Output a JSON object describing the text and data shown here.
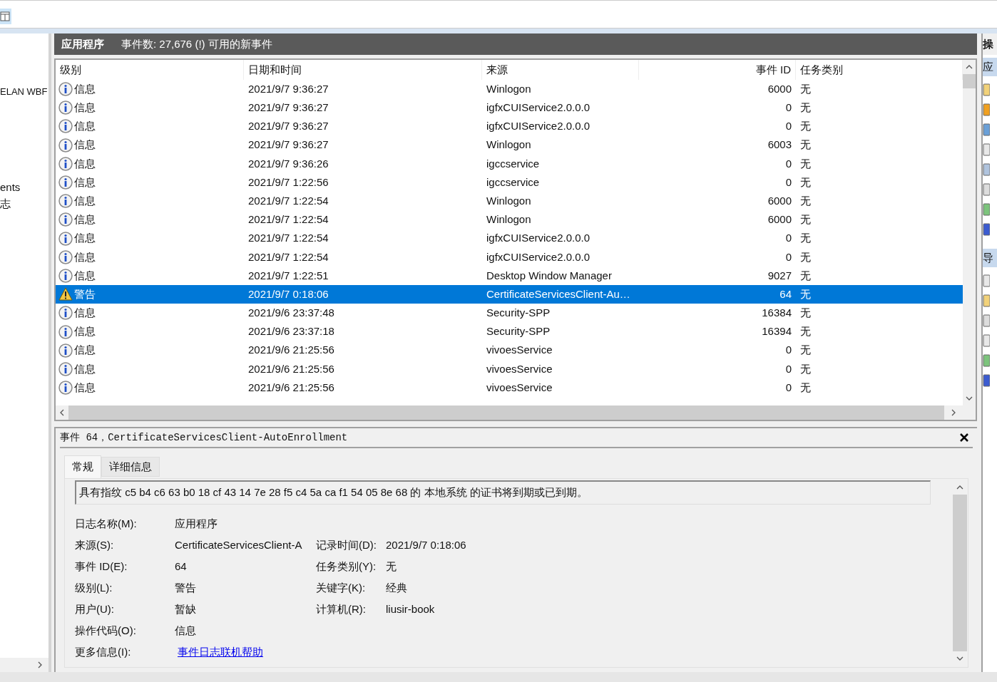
{
  "sidebar": {
    "items": [
      {
        "label": "ELAN WBF"
      },
      {
        "label": "ents"
      },
      {
        "label": "志"
      }
    ]
  },
  "log_header": {
    "title": "应用程序",
    "summary": "事件数: 27,676 (!) 可用的新事件"
  },
  "table": {
    "columns": [
      "级别",
      "日期和时间",
      "来源",
      "事件 ID",
      "任务类别"
    ],
    "rows": [
      {
        "kind": "info",
        "level": "信息",
        "datetime": "2021/9/7 9:36:27",
        "source": "Winlogon",
        "event_id": "6000",
        "task": "无",
        "selected": false
      },
      {
        "kind": "info",
        "level": "信息",
        "datetime": "2021/9/7 9:36:27",
        "source": "igfxCUIService2.0.0.0",
        "event_id": "0",
        "task": "无",
        "selected": false
      },
      {
        "kind": "info",
        "level": "信息",
        "datetime": "2021/9/7 9:36:27",
        "source": "igfxCUIService2.0.0.0",
        "event_id": "0",
        "task": "无",
        "selected": false
      },
      {
        "kind": "info",
        "level": "信息",
        "datetime": "2021/9/7 9:36:27",
        "source": "Winlogon",
        "event_id": "6003",
        "task": "无",
        "selected": false
      },
      {
        "kind": "info",
        "level": "信息",
        "datetime": "2021/9/7 9:36:26",
        "source": "igccservice",
        "event_id": "0",
        "task": "无",
        "selected": false
      },
      {
        "kind": "info",
        "level": "信息",
        "datetime": "2021/9/7 1:22:56",
        "source": "igccservice",
        "event_id": "0",
        "task": "无",
        "selected": false
      },
      {
        "kind": "info",
        "level": "信息",
        "datetime": "2021/9/7 1:22:54",
        "source": "Winlogon",
        "event_id": "6000",
        "task": "无",
        "selected": false
      },
      {
        "kind": "info",
        "level": "信息",
        "datetime": "2021/9/7 1:22:54",
        "source": "Winlogon",
        "event_id": "6000",
        "task": "无",
        "selected": false
      },
      {
        "kind": "info",
        "level": "信息",
        "datetime": "2021/9/7 1:22:54",
        "source": "igfxCUIService2.0.0.0",
        "event_id": "0",
        "task": "无",
        "selected": false
      },
      {
        "kind": "info",
        "level": "信息",
        "datetime": "2021/9/7 1:22:54",
        "source": "igfxCUIService2.0.0.0",
        "event_id": "0",
        "task": "无",
        "selected": false
      },
      {
        "kind": "info",
        "level": "信息",
        "datetime": "2021/9/7 1:22:51",
        "source": "Desktop Window Manager",
        "event_id": "9027",
        "task": "无",
        "selected": false
      },
      {
        "kind": "warning",
        "level": "警告",
        "datetime": "2021/9/7 0:18:06",
        "source": "CertificateServicesClient-Au…",
        "event_id": "64",
        "task": "无",
        "selected": true
      },
      {
        "kind": "info",
        "level": "信息",
        "datetime": "2021/9/6 23:37:48",
        "source": "Security-SPP",
        "event_id": "16384",
        "task": "无",
        "selected": false
      },
      {
        "kind": "info",
        "level": "信息",
        "datetime": "2021/9/6 23:37:18",
        "source": "Security-SPP",
        "event_id": "16394",
        "task": "无",
        "selected": false
      },
      {
        "kind": "info",
        "level": "信息",
        "datetime": "2021/9/6 21:25:56",
        "source": "vivoesService",
        "event_id": "0",
        "task": "无",
        "selected": false
      },
      {
        "kind": "info",
        "level": "信息",
        "datetime": "2021/9/6 21:25:56",
        "source": "vivoesService",
        "event_id": "0",
        "task": "无",
        "selected": false
      },
      {
        "kind": "info",
        "level": "信息",
        "datetime": "2021/9/6 21:25:56",
        "source": "vivoesService",
        "event_id": "0",
        "task": "无",
        "selected": false
      }
    ]
  },
  "details": {
    "title": "事件 64，CertificateServicesClient-AutoEnrollment",
    "tabs": [
      {
        "label": "常规",
        "selected": true
      },
      {
        "label": "详细信息",
        "selected": false
      }
    ],
    "message": "具有指纹 c5 b4 c6 63 b0 18 cf 43 14 7e 28 f5 c4 5a ca f1 54 05 8e 68 的 本地系统 的证书将到期或已到期。",
    "rows": [
      [
        {
          "label": "日志名称(M):",
          "value": "应用程序",
          "kind": "text"
        }
      ],
      [
        {
          "label": "来源(S):",
          "value": "CertificateServicesClient-A",
          "kind": "text"
        },
        {
          "label": "记录时间(D):",
          "value": "2021/9/7 0:18:06",
          "kind": "text"
        }
      ],
      [
        {
          "label": "事件 ID(E):",
          "value": "64",
          "kind": "text"
        },
        {
          "label": "任务类别(Y):",
          "value": "无",
          "kind": "text"
        }
      ],
      [
        {
          "label": "级别(L):",
          "value": "警告",
          "kind": "text"
        },
        {
          "label": "关键字(K):",
          "value": "经典",
          "kind": "text"
        }
      ],
      [
        {
          "label": "用户(U):",
          "value": "暂缺",
          "kind": "text"
        },
        {
          "label": "计算机(R):",
          "value": "liusir-book",
          "kind": "text"
        }
      ],
      [
        {
          "label": "操作代码(O):",
          "value": "信息",
          "kind": "text"
        }
      ],
      [
        {
          "label": "更多信息(I):",
          "value": "事件日志联机帮助",
          "kind": "link"
        }
      ]
    ]
  },
  "actions": {
    "header": "操",
    "sections": [
      {
        "title": "应"
      },
      {
        "title": "导"
      }
    ]
  }
}
